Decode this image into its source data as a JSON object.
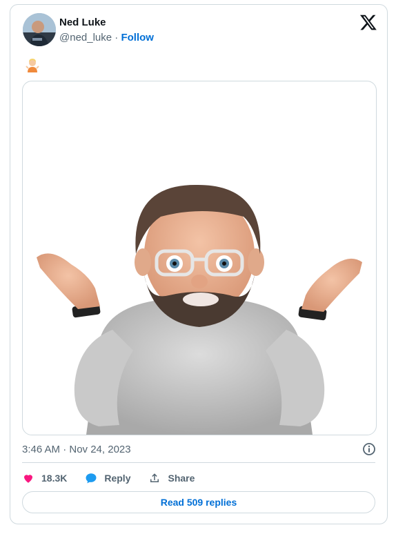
{
  "tweet": {
    "author_name": "Ned Luke",
    "handle": "@ned_luke",
    "separator": " · ",
    "follow_label": "Follow",
    "emoji_icon": "person-shrugging-emoji",
    "media": "memoji-person-shrugging-image",
    "timestamp": "3:46 AM · Nov 24, 2023",
    "likes": "18.3K",
    "reply_label": "Reply",
    "share_label": "Share",
    "read_replies_label": "Read 509 replies"
  },
  "colors": {
    "accent": "#006fd6",
    "like": "#f91880",
    "reply_icon": "#1d9bf0",
    "text_secondary": "#536471",
    "border": "#cfd9de"
  }
}
